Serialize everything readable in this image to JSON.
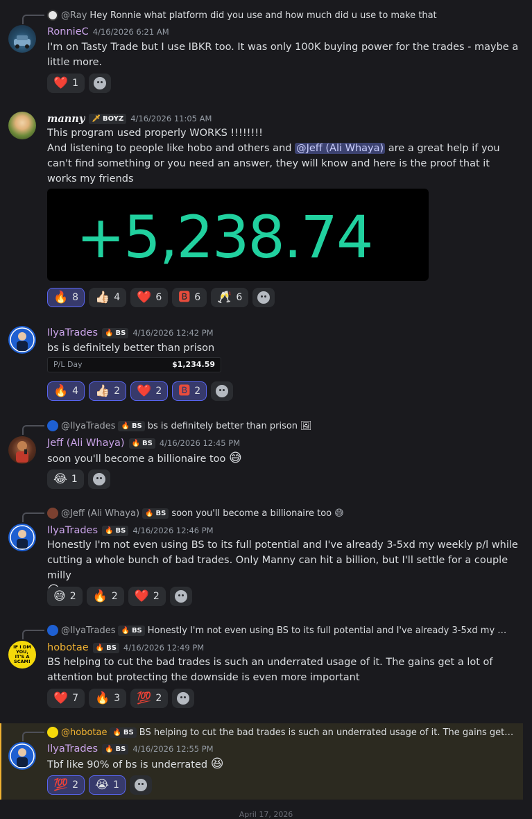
{
  "messages": [
    {
      "reply": {
        "name": "@Ray",
        "text": "Hey Ronnie what platform did you use and how much did u use to make that"
      },
      "user": "RonnieC",
      "time": "4/16/2026 6:21 AM",
      "text": "I'm on Tasty Trade but I use IBKR too.  It was only 100K buying power for the trades - maybe a little more.",
      "reactions": [
        {
          "emoji": "❤️",
          "count": "1"
        }
      ]
    },
    {
      "user": "manny",
      "tag": "BOYZ",
      "time": "4/16/2026 11:05 AM",
      "line1": "This program used properly WORKS !!!!!!!!",
      "line2_a": "And listening to people like hobo and others and ",
      "mention": "@Jeff (Ali Whaya)",
      "line2_b": " are a great help if you can't find something or you need an answer, they will know and here is the proof that it works my friends",
      "image_text": "+5,238.74",
      "reactions": [
        {
          "emoji": "🔥",
          "count": "8"
        },
        {
          "emoji": "👍🏻",
          "count": "4"
        },
        {
          "emoji": "❤️",
          "count": "6"
        },
        {
          "emoji": "🅱",
          "count": "6"
        },
        {
          "emoji": "🥂",
          "count": "6"
        }
      ]
    },
    {
      "user": "IlyaTrades",
      "tag": "BS",
      "time": "4/16/2026 12:42 PM",
      "text": "bs is definitely better than prison",
      "pl_label": "P/L Day",
      "pl_value": "$1,234.59",
      "reactions": [
        {
          "emoji": "🔥",
          "count": "4"
        },
        {
          "emoji": "👍🏻",
          "count": "2"
        },
        {
          "emoji": "❤️",
          "count": "2"
        },
        {
          "emoji": "🅱",
          "count": "2"
        }
      ]
    },
    {
      "reply": {
        "name": "@IlyaTrades",
        "tag": "BS",
        "text": "bs is definitely better than prison",
        "icon": "🖼"
      },
      "user": "Jeff (Ali Whaya)",
      "tag": "BS",
      "time": "4/16/2026 12:45 PM",
      "text": "soon you'll become a billionaire too",
      "emoji": "😅",
      "reactions": [
        {
          "emoji": "😂",
          "count": "1"
        }
      ]
    },
    {
      "reply": {
        "name": "@Jeff (Ali Whaya)",
        "tag": "BS",
        "text": "soon you'll become a billionaire too",
        "emoji": "😅"
      },
      "user": "IlyaTrades",
      "tag": "BS",
      "time": "4/16/2026 12:46 PM",
      "text": "Honestly I'm not even using BS to its full potential and I've already 3-5xd my weekly p/l while cutting a whole bunch of bad trades. Only Manny can hit a billion, but I'll settle for a couple milly",
      "emoji": "😆",
      "reactions": [
        {
          "emoji": "😅",
          "count": "2"
        },
        {
          "emoji": "🔥",
          "count": "2"
        },
        {
          "emoji": "❤️",
          "count": "2"
        }
      ]
    },
    {
      "reply": {
        "name": "@IlyaTrades",
        "tag": "BS",
        "text": "Honestly I'm not even using BS to its full potential and I've already 3-5xd my weekly p/l..."
      },
      "user": "hobotae",
      "tag": "BS",
      "time": "4/16/2026 12:49 PM",
      "avatar_text": "IF I DM YOU, IT'S A SCAM!",
      "text": "BS helping to cut the bad trades is such an underrated usage of it. The gains get a lot of attention but protecting the downside is even more important",
      "reactions": [
        {
          "emoji": "❤️",
          "count": "7"
        },
        {
          "emoji": "🔥",
          "count": "3"
        },
        {
          "emoji": "💯",
          "count": "2"
        }
      ]
    },
    {
      "reply": {
        "name": "@hobotae",
        "tag": "BS",
        "text": "BS helping to cut the bad trades is such an underrated usage of it. The gains get a lot of ..."
      },
      "user": "IlyaTrades",
      "tag": "BS",
      "time": "4/16/2026 12:55 PM",
      "text": "Tbf like 90% of bs is underrated",
      "emoji": "😆",
      "reactions": [
        {
          "emoji": "💯",
          "count": "2"
        },
        {
          "emoji": "😭",
          "count": "1"
        }
      ]
    }
  ],
  "date_divider": "April 17, 2026",
  "colors": {
    "ronnie": "#c9a3e8",
    "manny": "#f2f3f5",
    "ilya": "#c9a3e8",
    "jeff": "#c9a3e8",
    "hobo": "#f0b232",
    "accent": "#5865f2"
  }
}
